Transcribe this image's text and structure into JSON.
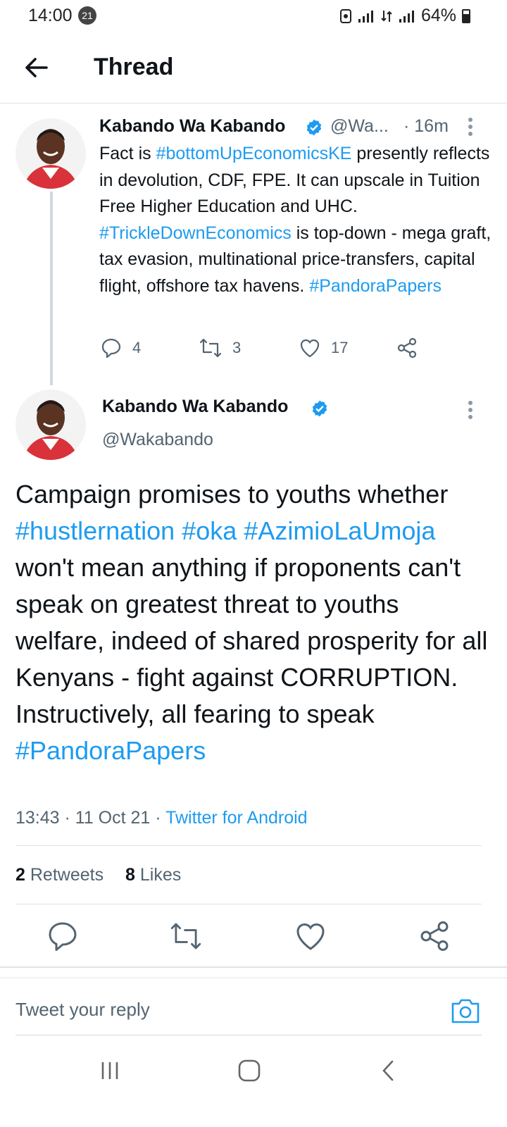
{
  "status_bar": {
    "time": "14:00",
    "notification_count": "21",
    "battery": "64%"
  },
  "header": {
    "title": "Thread",
    "back_icon": "arrow-left-icon"
  },
  "tweet_1": {
    "name": "Kabando Wa Kabando",
    "handle": "@Wa...",
    "time": "· 16m",
    "text_parts": [
      {
        "text": "Fact is ",
        "tag": false
      },
      {
        "text": "#bottomUpEconomicsKE",
        "tag": true
      },
      {
        "text": " presently reflects in devolution, CDF, FPE. It can upscale in Tuition Free Higher Education and UHC. ",
        "tag": false
      },
      {
        "text": "#TrickleDownEconomics",
        "tag": true
      },
      {
        "text": " is top-down -  mega graft, tax evasion, multinational price-transfers, capital flight, offshore tax havens. ",
        "tag": false
      },
      {
        "text": "#PandoraPapers",
        "tag": true
      }
    ],
    "replies": "4",
    "retweets": "3",
    "likes": "17"
  },
  "tweet_2": {
    "name": "Kabando Wa Kabando",
    "handle": "@Wakabando",
    "text_parts": [
      {
        "text": "Campaign promises  to youths whether ",
        "tag": false
      },
      {
        "text": "#hustlernation",
        "tag": true
      },
      {
        "text": " ",
        "tag": false
      },
      {
        "text": "#oka",
        "tag": true
      },
      {
        "text": " ",
        "tag": false
      },
      {
        "text": "#AzimioLaUmoja",
        "tag": true
      },
      {
        "text": " won't mean anything if proponents can't speak on greatest threat to youths welfare, indeed of shared prosperity for all Kenyans - fight against CORRUPTION. Instructively, all fearing to speak ",
        "tag": false
      },
      {
        "text": "#PandoraPapers",
        "tag": true
      }
    ],
    "timestamp": "13:43 · 11 Oct 21 · ",
    "source": "Twitter for Android",
    "retweet_count": "2",
    "retweet_label": "Retweets",
    "like_count": "8",
    "like_label": "Likes"
  },
  "reply_box": {
    "placeholder": "Tweet your reply"
  },
  "colors": {
    "accent": "#1d9bf0",
    "text": "#0f1419",
    "muted": "#536471",
    "divider": "#dfe3e6"
  }
}
